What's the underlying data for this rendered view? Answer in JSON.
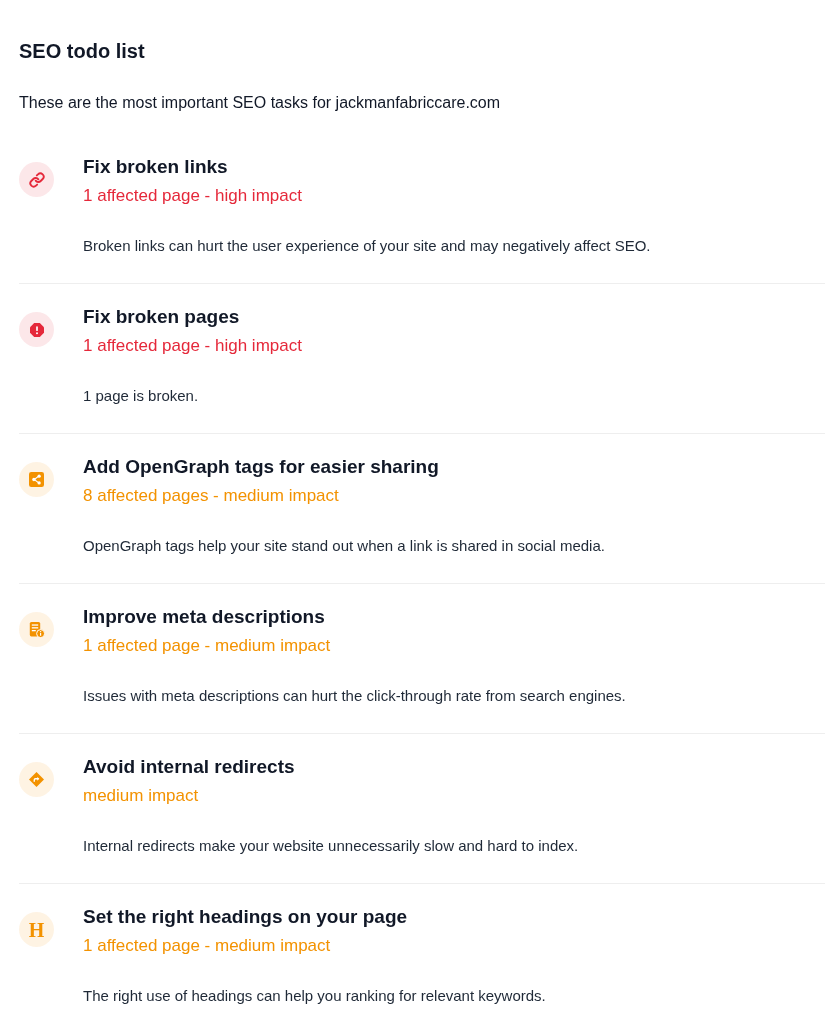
{
  "title": "SEO todo list",
  "intro": "These are the most important SEO tasks for jackmanfabriccare.com",
  "tasks": [
    {
      "title": "Fix broken links",
      "impact": "1 affected page - high impact",
      "color": "#e5283a",
      "description": "Broken links can hurt the user experience of your site and may negatively affect SEO."
    },
    {
      "title": "Fix broken pages",
      "impact": "1 affected page - high impact",
      "color": "#e5283a",
      "description": "1 page is broken."
    },
    {
      "title": "Add OpenGraph tags for easier sharing",
      "impact": "8 affected pages - medium impact",
      "color": "#f39200",
      "description": "OpenGraph tags help your site stand out when a link is shared in social media."
    },
    {
      "title": "Improve meta descriptions",
      "impact": "1 affected page - medium impact",
      "color": "#f39200",
      "description": "Issues with meta descriptions can hurt the click-through rate from search engines."
    },
    {
      "title": "Avoid internal redirects",
      "impact": "medium impact",
      "color": "#f39200",
      "description": "Internal redirects make your website unnecessarily slow and hard to index."
    },
    {
      "title": "Set the right headings on your page",
      "impact": "1 affected page - medium impact",
      "color": "#f39200",
      "icon_glyph": "H",
      "description": "The right use of headings can help you ranking for relevant keywords."
    }
  ]
}
